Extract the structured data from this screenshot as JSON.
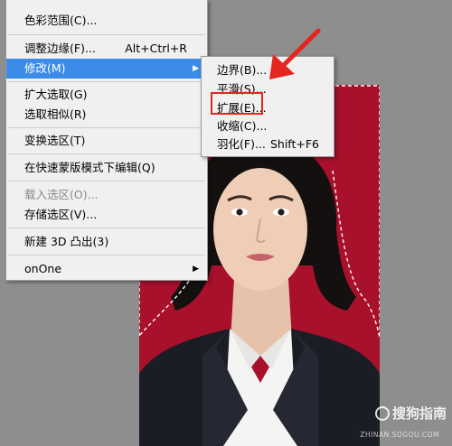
{
  "main_menu": {
    "items": [
      {
        "label": "色彩范围(C)...",
        "shortcut": "",
        "submenu": false,
        "disabled": false,
        "highlight": false
      },
      {
        "label": "调整边缘(F)...",
        "shortcut": "Alt+Ctrl+R",
        "submenu": false,
        "disabled": false,
        "highlight": false
      },
      {
        "label": "修改(M)",
        "shortcut": "",
        "submenu": true,
        "disabled": false,
        "highlight": true
      },
      {
        "label": "扩大选取(G)",
        "shortcut": "",
        "submenu": false,
        "disabled": false,
        "highlight": false
      },
      {
        "label": "选取相似(R)",
        "shortcut": "",
        "submenu": false,
        "disabled": false,
        "highlight": false
      },
      {
        "label": "变换选区(T)",
        "shortcut": "",
        "submenu": false,
        "disabled": false,
        "highlight": false
      },
      {
        "label": "在快速蒙版模式下编辑(Q)",
        "shortcut": "",
        "submenu": false,
        "disabled": false,
        "highlight": false
      },
      {
        "label": "载入选区(O)...",
        "shortcut": "",
        "submenu": false,
        "disabled": true,
        "highlight": false
      },
      {
        "label": "存储选区(V)...",
        "shortcut": "",
        "submenu": false,
        "disabled": false,
        "highlight": false
      },
      {
        "label": "新建 3D 凸出(3)",
        "shortcut": "",
        "submenu": false,
        "disabled": false,
        "highlight": false
      },
      {
        "label": "onOne",
        "shortcut": "",
        "submenu": true,
        "disabled": false,
        "highlight": false
      }
    ]
  },
  "submenu": {
    "items": [
      {
        "label": "边界(B)...",
        "shortcut": ""
      },
      {
        "label": "平滑(S)...",
        "shortcut": ""
      },
      {
        "label": "扩展(E)...",
        "shortcut": ""
      },
      {
        "label": "收缩(C)...",
        "shortcut": ""
      },
      {
        "label": "羽化(F)...",
        "shortcut": "Shift+F6"
      }
    ]
  },
  "colors": {
    "menu_highlight": "#3c8be8",
    "annotation": "#e5251f",
    "photo_background": "#a8102c"
  },
  "watermark": {
    "brand": "搜狗指南",
    "url": "ZHINAN.SOGOU.COM"
  },
  "icons": [
    "submenu-arrow-icon",
    "annotation-arrow-icon",
    "sogou-logo-icon"
  ]
}
